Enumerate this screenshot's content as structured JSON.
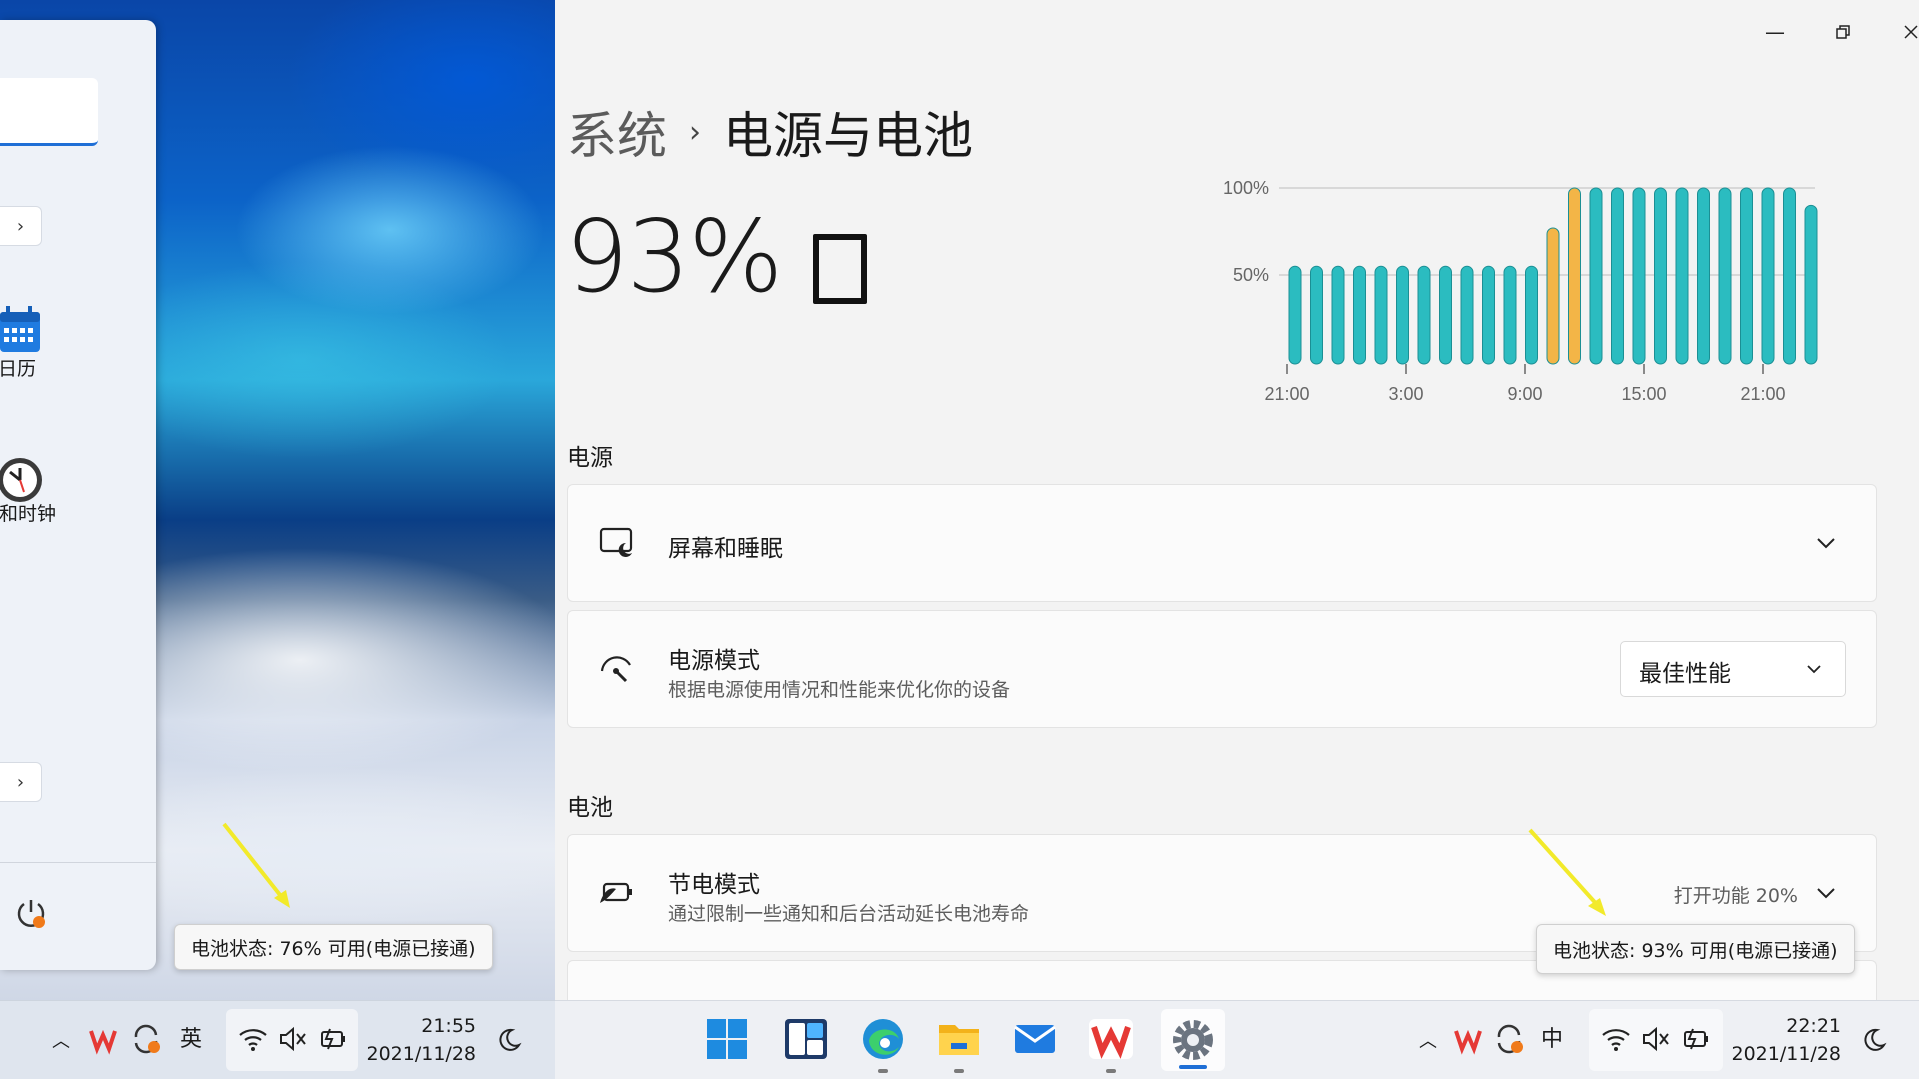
{
  "left": {
    "calendar_label": "日历",
    "clock_label": "钟和时钟",
    "tooltip": "电池状态: 76% 可用(电源已接通)",
    "taskbar": {
      "ime": "英",
      "time": "21:55",
      "date": "2021/11/28"
    }
  },
  "window": {
    "breadcrumb_parent": "系统",
    "breadcrumb_sep": "›",
    "title": "电源与电池",
    "battery_percent": "93%"
  },
  "chart_data": {
    "type": "bar",
    "x": [
      "21:00",
      "3:00",
      "9:00",
      "15:00",
      "21:00"
    ],
    "ytick_labels": [
      "100%",
      "50%"
    ],
    "ylim": [
      0,
      100
    ],
    "values": [
      55,
      55,
      55,
      55,
      55,
      55,
      55,
      55,
      55,
      55,
      55,
      55,
      77,
      100,
      100,
      100,
      100,
      100,
      100,
      100,
      100,
      100,
      100,
      100,
      90
    ],
    "bar_status": [
      "normal",
      "normal",
      "normal",
      "normal",
      "normal",
      "normal",
      "normal",
      "normal",
      "normal",
      "normal",
      "normal",
      "normal",
      "charging",
      "charging",
      "normal",
      "normal",
      "normal",
      "normal",
      "normal",
      "normal",
      "normal",
      "normal",
      "normal",
      "normal",
      "normal"
    ],
    "colors": {
      "normal": "#2bbcc0",
      "charging": "#f3b547",
      "grid": "#d0d0d0",
      "axis": "#666666"
    }
  },
  "power": {
    "section_title": "电源",
    "screen_sleep": {
      "title": "屏幕和睡眠"
    },
    "power_mode": {
      "title": "电源模式",
      "subtitle": "根据电源使用情况和性能来优化你的设备",
      "value": "最佳性能"
    }
  },
  "battery": {
    "section_title": "电池",
    "saver": {
      "title": "节电模式",
      "subtitle": "通过限制一些通知和后台活动延长电池寿命",
      "status": "打开功能 20%"
    },
    "tooltip": "电池状态: 93% 可用(电源已接通)"
  },
  "taskbar": {
    "ime": "中",
    "time": "22:21",
    "date": "2021/11/28"
  }
}
